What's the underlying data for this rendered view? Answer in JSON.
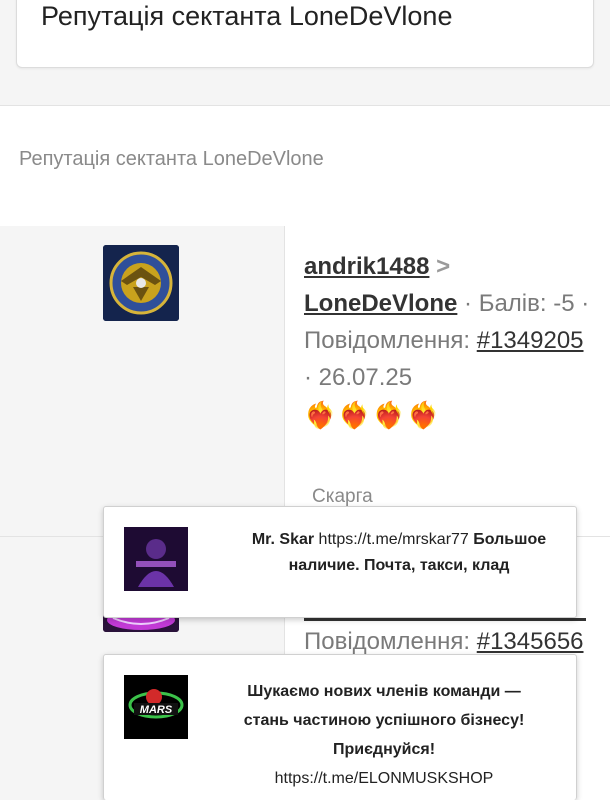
{
  "page": {
    "title": "Репутація сектанта LoneDeVlone",
    "subtitle": "Репутація сектанта LoneDeVlone"
  },
  "entries": [
    {
      "from": "andrik1488",
      "arrow": ">",
      "to": "LoneDeVlone",
      "points_label": "· Балів: -5 ·",
      "message_label": "Повідомлення:",
      "message_id": "#1349205",
      "date": "· 26.07.25",
      "reactions": "❤️‍🔥❤️‍🔥❤️‍🔥❤️‍🔥",
      "complaint": "Скарга"
    },
    {
      "message_label": "Повідомлення:",
      "message_id": "#1345656"
    }
  ],
  "popups": [
    {
      "name": "Mr. Skar",
      "link": "https://t.me/mrskar77",
      "text": "Большое наличие. Почта, такси, клад"
    },
    {
      "line1": "Шукаємо нових членів команди —",
      "line2": "стань частиною успішного бізнесу!",
      "line3": "Приєднуйся!",
      "link": "https://t.me/ELONMUSKSHOP"
    }
  ],
  "colors": {
    "background": "#f5f5f5",
    "card": "#ffffff",
    "link": "#333333",
    "muted": "#7a7a7a"
  }
}
